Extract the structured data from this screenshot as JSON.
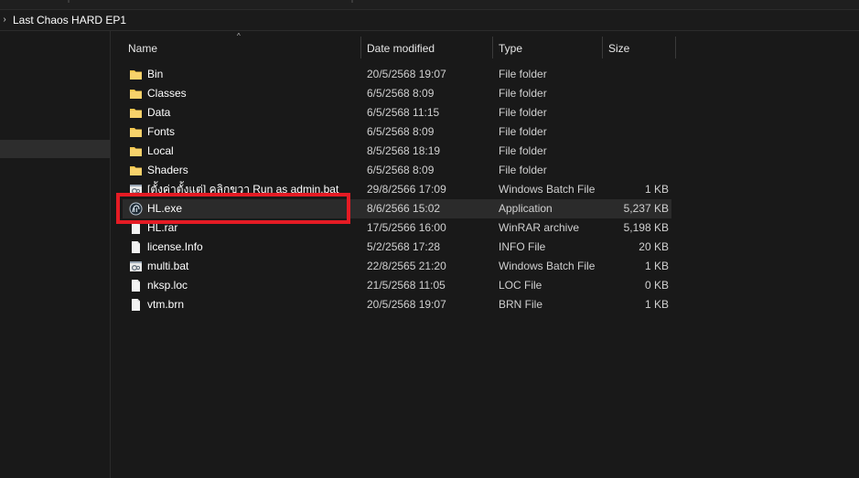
{
  "address": {
    "chevron": "›",
    "path_label": "Last Chaos HARD EP1"
  },
  "columns": {
    "name": "Name",
    "date": "Date modified",
    "type": "Type",
    "size": "Size",
    "sort_indicator": "^"
  },
  "files": [
    {
      "name": "Bin",
      "date": "20/5/2568 19:07",
      "type": "File folder",
      "size": "",
      "icon": "folder-icon"
    },
    {
      "name": "Classes",
      "date": "6/5/2568 8:09",
      "type": "File folder",
      "size": "",
      "icon": "folder-icon"
    },
    {
      "name": "Data",
      "date": "6/5/2568 11:15",
      "type": "File folder",
      "size": "",
      "icon": "folder-icon"
    },
    {
      "name": "Fonts",
      "date": "6/5/2568 8:09",
      "type": "File folder",
      "size": "",
      "icon": "folder-icon"
    },
    {
      "name": "Local",
      "date": "8/5/2568 18:19",
      "type": "File folder",
      "size": "",
      "icon": "folder-icon"
    },
    {
      "name": "Shaders",
      "date": "6/5/2568 8:09",
      "type": "File folder",
      "size": "",
      "icon": "folder-icon"
    },
    {
      "name": "[ตั้งค่าตั้งแต่] คลิกขวา Run as admin.bat",
      "date": "29/8/2566 17:09",
      "type": "Windows Batch File",
      "size": "1 KB",
      "icon": "batch-file-icon"
    },
    {
      "name": "HL.exe",
      "date": "8/6/2566 15:02",
      "type": "Application",
      "size": "5,237 KB",
      "icon": "application-icon"
    },
    {
      "name": "HL.rar",
      "date": "17/5/2566 16:00",
      "type": "WinRAR archive",
      "size": "5,198 KB",
      "icon": "document-icon"
    },
    {
      "name": "license.Info",
      "date": "5/2/2568 17:28",
      "type": "INFO File",
      "size": "20 KB",
      "icon": "document-icon"
    },
    {
      "name": "multi.bat",
      "date": "22/8/2565 21:20",
      "type": "Windows Batch File",
      "size": "1 KB",
      "icon": "batch-file-icon"
    },
    {
      "name": "nksp.loc",
      "date": "21/5/2568 11:05",
      "type": "LOC File",
      "size": "0 KB",
      "icon": "document-icon"
    },
    {
      "name": "vtm.brn",
      "date": "20/5/2568 19:07",
      "type": "BRN File",
      "size": "1 KB",
      "icon": "document-icon"
    }
  ],
  "colors": {
    "background": "#191919",
    "folder_yellow": "#f7d26b",
    "highlight_red": "#e51b24",
    "hover_row": "#2b2b2b"
  }
}
